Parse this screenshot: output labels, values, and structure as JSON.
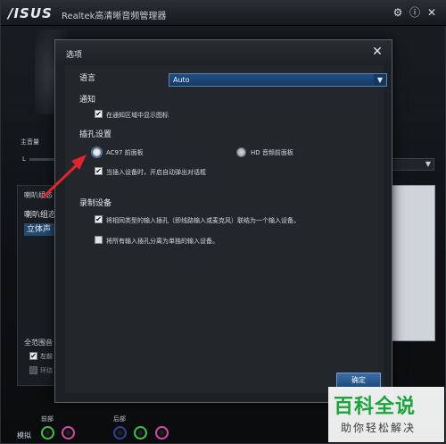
{
  "app": {
    "brand": "/ISUS",
    "title": "Realtek高清晰音频管理器",
    "icons": {
      "settings": "gear-icon",
      "help": "info-icon",
      "close": "close-icon"
    }
  },
  "main": {
    "master_volume_label": "主音量",
    "lr_label": "L",
    "left_panel": {
      "tab_label": "喇叭组态",
      "title": "喇叭组态",
      "speaker_button": "立体声",
      "full_range_label": "全范围音",
      "check_front": "左前",
      "check_rear": "环绕"
    },
    "bottom": {
      "front_label": "前部",
      "back_label": "后部",
      "analog_label": "模拟"
    }
  },
  "dialog": {
    "title": "选项",
    "language_label": "语言",
    "language_value": "Auto",
    "notify_header": "通知",
    "notify_tray": "在通知区域中显示图标",
    "jack_header": "插孔设置",
    "radio_ac97": "AC97 前面板",
    "radio_hd": "HD 音频前面板",
    "popup_on_plug": "当插入设备时，开启自动弹出对话框",
    "record_header": "录制设备",
    "merge_inputs": "将相同类型的输入插孔（即线路输入或麦克风）联结为一个输入设备。",
    "separate_inputs": "将所有输入插孔分离为单独的输入设备。",
    "ok_button": "确定",
    "language_checked": true,
    "notify_checked": true,
    "ac97_selected": true,
    "popup_checked": true,
    "merge_checked": true,
    "separate_checked": false
  },
  "watermark": {
    "main": "百科全说",
    "sub": "助你轻松解决"
  },
  "colors": {
    "accent_blue": "#1f4e84",
    "arrow_red": "#e0242b",
    "watermark_green": "#1aa53a"
  }
}
